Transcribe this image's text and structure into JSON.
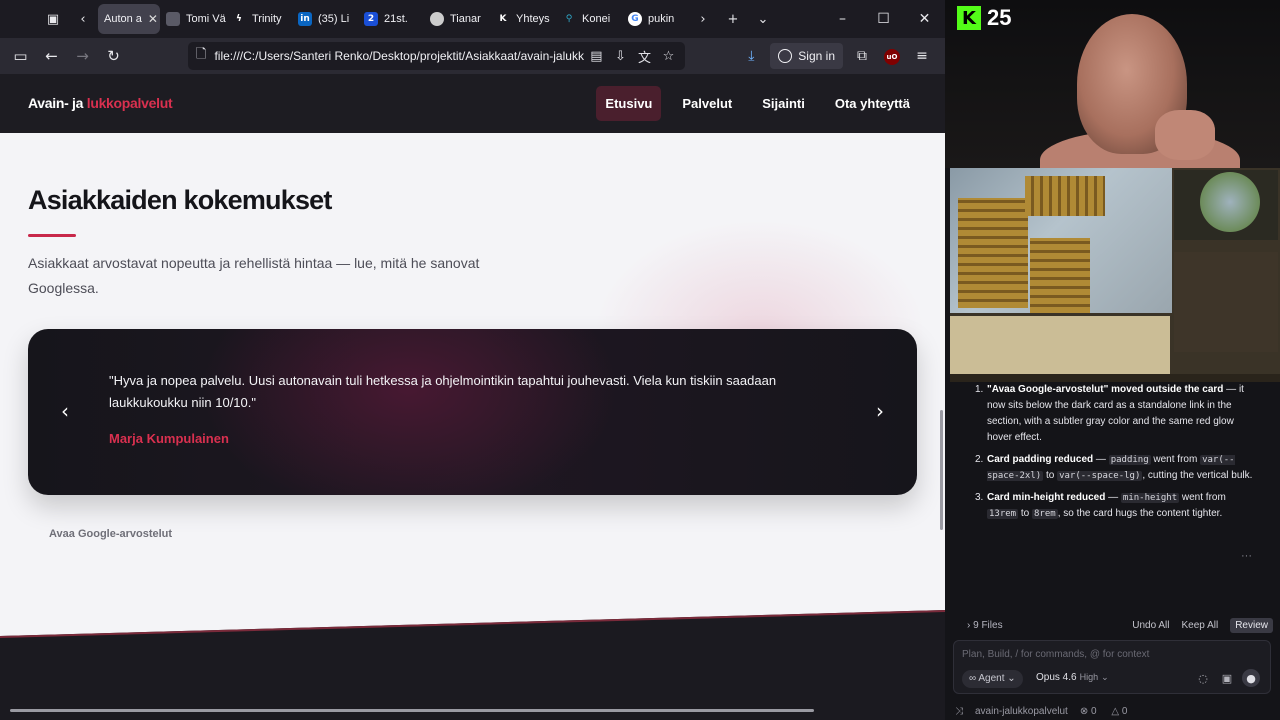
{
  "browser": {
    "tabs": [
      {
        "label": "Auton a",
        "active": true,
        "icon": "page-icon",
        "color": "#42414d"
      },
      {
        "label": "Tomi Välin",
        "icon": "tomi-favicon",
        "color": "#2b2a33"
      },
      {
        "label": "Trinity",
        "icon": "trinity-favicon",
        "color": "#2b2a33"
      },
      {
        "label": "(35) Li",
        "icon": "linkedin-favicon",
        "color": "#0a66c2"
      },
      {
        "label": "21st.",
        "icon": "21st-favicon",
        "color": "#1a4fd6"
      },
      {
        "label": "Tianar",
        "icon": "tianar-favicon",
        "color": "#2b2a33"
      },
      {
        "label": "Yhteys",
        "icon": "k-favicon",
        "color": "#2b2a33"
      },
      {
        "label": "Konei",
        "icon": "pin-favicon",
        "color": "#2b2a33"
      },
      {
        "label": "pukin",
        "icon": "google-favicon",
        "color": "#2b2a33"
      }
    ],
    "url": "file:///C:/Users/Santeri Renko/Desktop/projektit/Asiakkaat/avain-jalukk",
    "sign_in": "Sign in"
  },
  "site": {
    "logo_main": "Avain- ja ",
    "logo_accent": "lukkopalvelut",
    "nav": [
      "Etusivu",
      "Palvelut",
      "Sijainti",
      "Ota yhteyttä"
    ],
    "section_title": "Asiakkaiden kokemukset",
    "section_lead": "Asiakkaat arvostavat nopeutta ja rehellistä hintaa — lue, mitä he sanovat Googlessa.",
    "testimonial_quote": "\"Hyva ja nopea palvelu. Uusi autonavain tuli hetkessa ja ohjelmointikin tapahtui jouhevasti. Viela kun tiskiin saadaan laukkukoukku niin 10/10.\"",
    "testimonial_author": "Marja Kumpulainen",
    "google_link": "Avaa Google-arvostelut",
    "colors": {
      "accent": "#d9304f",
      "dark": "#1d1c22"
    }
  },
  "stream": {
    "kick_count": "25"
  },
  "assistant": {
    "step1_title": "\"Avaa Google-arvostelut\" moved outside the card",
    "step1_body": " — it now sits below the dark card as a standalone link in the section, with a subtler gray color and the same red glow hover effect.",
    "step2_title": "Card padding reduced",
    "step2_a": " — ",
    "step2_code1": "padding",
    "step2_b": " went from ",
    "step2_code2": "var(--space-2xl)",
    "step2_c": " to ",
    "step2_code3": "var(--space-lg)",
    "step2_d": ", cutting the vertical bulk.",
    "step3_title": "Card min-height reduced",
    "step3_a": " — ",
    "step3_code1": "min-height",
    "step3_b": " went from ",
    "step3_code2": "13rem",
    "step3_c": " to ",
    "step3_code3": "8rem",
    "step3_d": ", so the card hugs the content tighter.",
    "files": "9 Files",
    "undo_all": "Undo All",
    "keep_all": "Keep All",
    "review": "Review",
    "input_placeholder": "Plan, Build, / for commands, @ for context",
    "agent_label": "Agent",
    "model": "Opus 4.6",
    "effort": "High",
    "project": "avain-jalukkopalvelut",
    "problems": "0",
    "warnings": "0"
  }
}
